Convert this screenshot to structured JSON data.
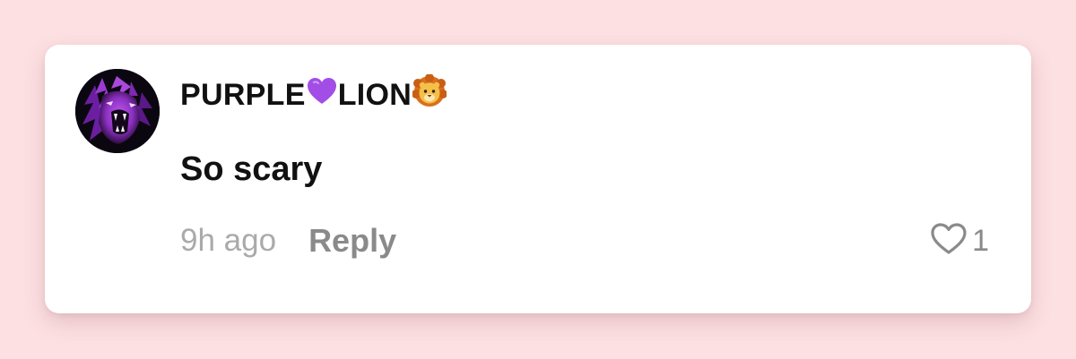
{
  "comment": {
    "username_parts": [
      "PURPLE",
      "LION"
    ],
    "username_icons": [
      "purple-heart-icon",
      "lion-face-icon"
    ],
    "text": "So scary",
    "timestamp": "9h ago",
    "reply_label": "Reply",
    "like_count": "1",
    "avatar_icon": "purple-lion-avatar"
  },
  "colors": {
    "background": "#fde0e2",
    "card": "#ffffff",
    "text_primary": "#111111",
    "timestamp": "#aaaaaa",
    "secondary": "#8a8a8a",
    "purple_heart": "#a24ee6",
    "lion": "#f2a23a"
  }
}
